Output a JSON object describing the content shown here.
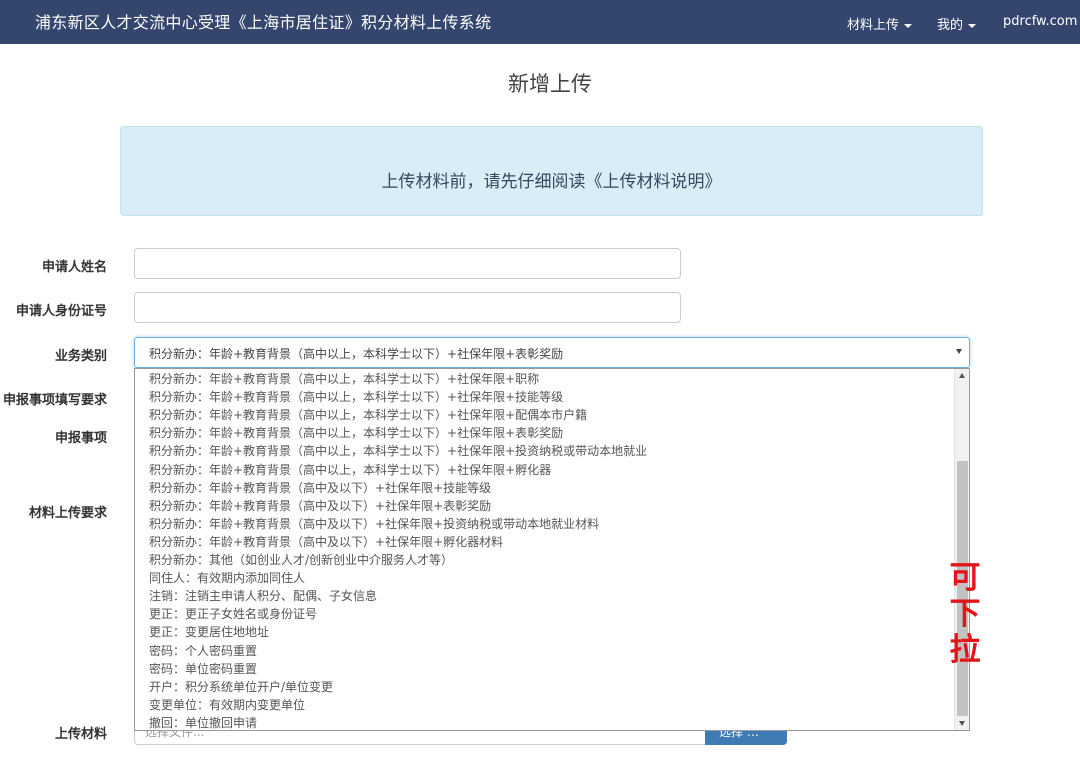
{
  "header": {
    "brand": "浦东新区人才交流中心受理《上海市居住证》积分材料上传系统",
    "menu_upload": "材料上传",
    "menu_mine": "我的",
    "menu_site": "pdrcfw.com"
  },
  "page_title": "新增上传",
  "notice": {
    "text_prefix": "上传材料前，请先仔细阅读",
    "link": "《上传材料说明》"
  },
  "form": {
    "labels": {
      "name": "申请人姓名",
      "id_number": "申请人身份证号",
      "business_type": "业务类别",
      "fill_requirements": "申报事项填写要求",
      "items": "申报事项",
      "upload_requirements": "材料上传要求",
      "upload_material": "上传材料"
    },
    "name_value": "",
    "id_value": "",
    "business_type_selected": "积分新办：年龄+教育背景（高中以上，本科学士以下）+社保年限+表彰奖励",
    "options": [
      "积分新办：年龄+教育背景（高中以上，本科学士以下）+社保年限+职称",
      "积分新办：年龄+教育背景（高中以上，本科学士以下）+社保年限+技能等级",
      "积分新办：年龄+教育背景（高中以上，本科学士以下）+社保年限+配偶本市户籍",
      "积分新办：年龄+教育背景（高中以上，本科学士以下）+社保年限+表彰奖励",
      "积分新办：年龄+教育背景（高中以上，本科学士以下）+社保年限+投资纳税或带动本地就业",
      "积分新办：年龄+教育背景（高中以上，本科学士以下）+社保年限+孵化器",
      "积分新办：年龄+教育背景（高中及以下）+社保年限+技能等级",
      "积分新办：年龄+教育背景（高中及以下）+社保年限+表彰奖励",
      "积分新办：年龄+教育背景（高中及以下）+社保年限+投资纳税或带动本地就业材料",
      "积分新办：年龄+教育背景（高中及以下）+社保年限+孵化器材料",
      "积分新办：其他（如创业人才/创新创业中介服务人才等）",
      "同住人：有效期内添加同住人",
      "注销：注销主申请人积分、配偶、子女信息",
      "更正：更正子女姓名或身份证号",
      "更正：变更居住地地址",
      "密码：个人密码重置",
      "密码：单位密码重置",
      "开户：积分系统单位开户/单位变更",
      "变更单位：有效期内变更单位",
      "撤回：单位撤回申请"
    ],
    "file_placeholder": "选择文件...",
    "file_button": "选择 …"
  },
  "annotation": [
    "可",
    "下",
    "拉"
  ],
  "colors": {
    "navbar": "#34466e",
    "notice_bg": "#d8edf6",
    "annotation": "#e3141a",
    "button": "#3f7cb6"
  }
}
